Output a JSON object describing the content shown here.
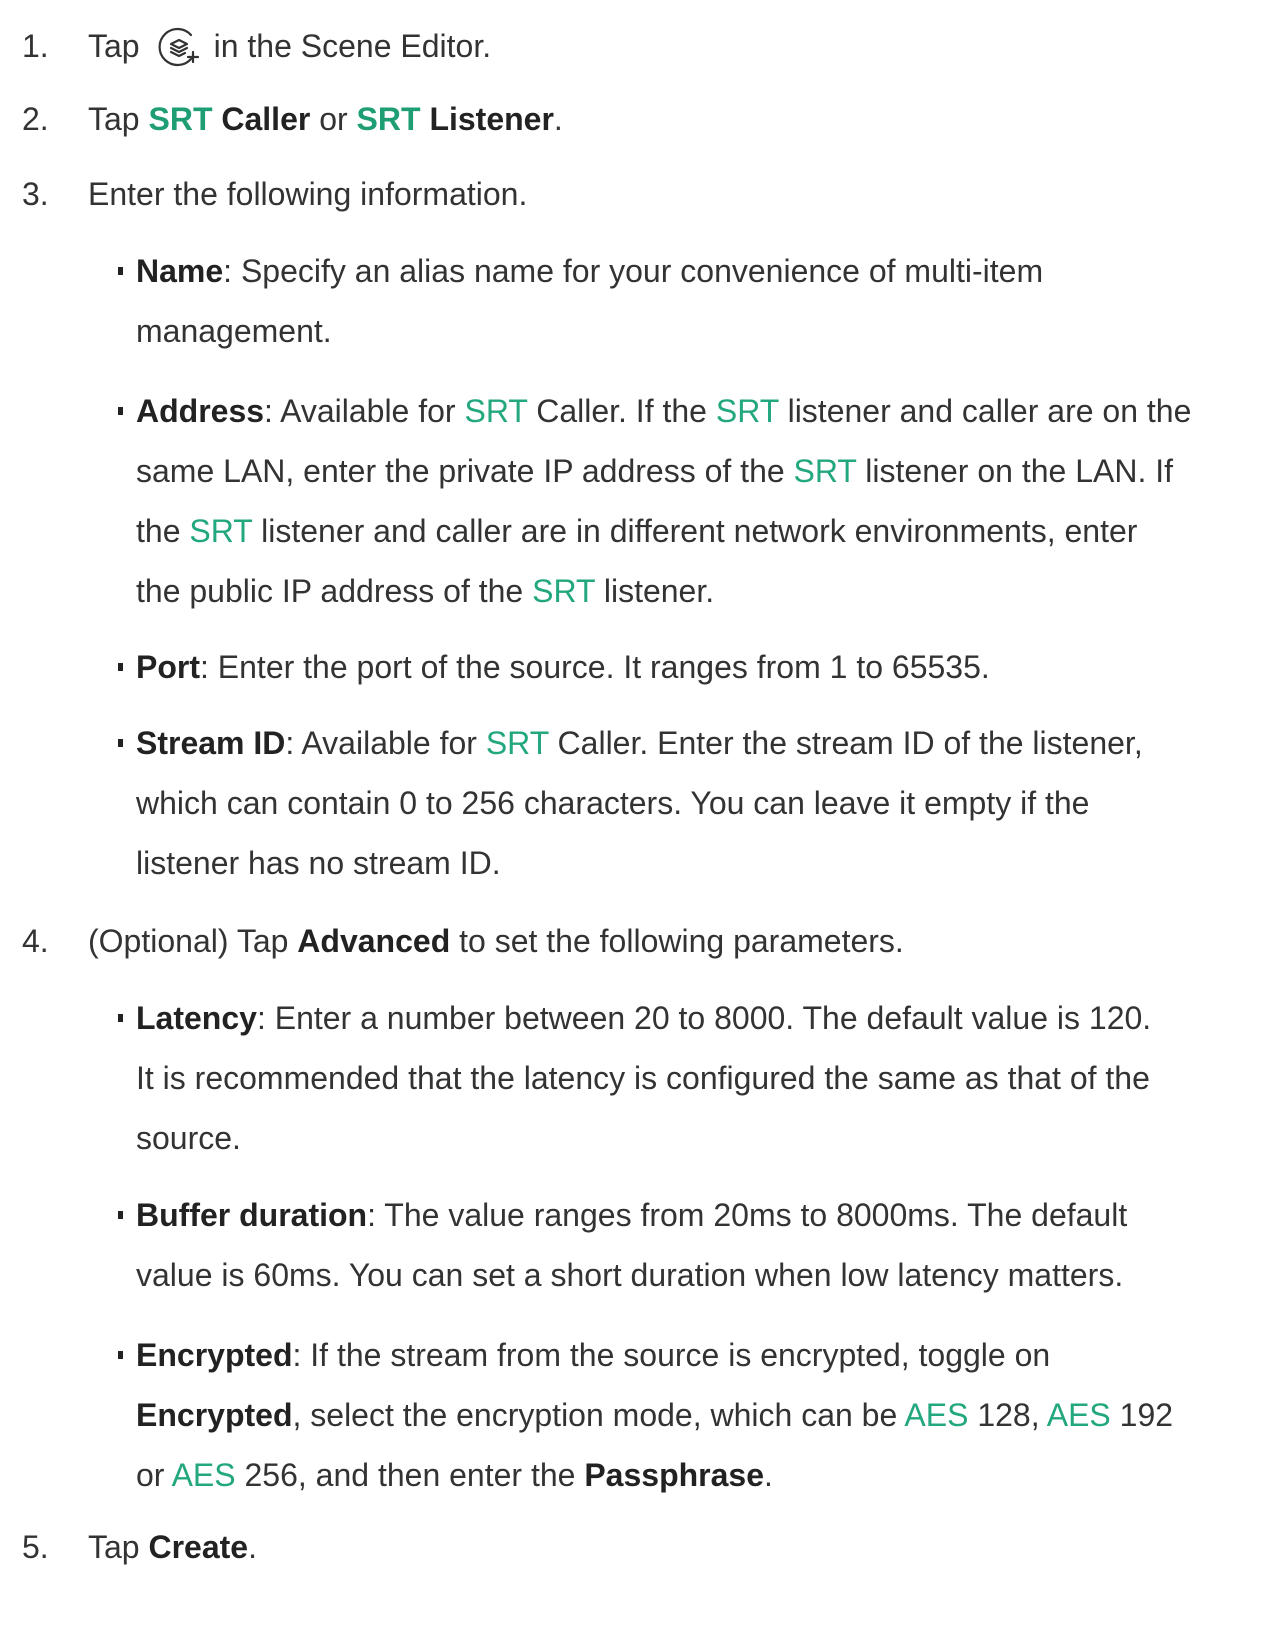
{
  "colors": {
    "accent": "#23a77e",
    "text": "#333333",
    "bold_text": "#222222"
  },
  "steps": [
    {
      "num": "1.",
      "before_icon": "Tap",
      "icon": "add-layer-icon",
      "after_icon": "in the Scene Editor."
    },
    {
      "num": "2.",
      "tap": "Tap",
      "srt1": "SRT",
      "caller": "Caller",
      "or": "or",
      "srt2": "SRT",
      "listener": "Listener",
      "end": "."
    },
    {
      "num": "3.",
      "text": "Enter the following information."
    },
    {
      "num": "4.",
      "before": "(Optional) Tap",
      "bold": "Advanced",
      "after": "to set the following parameters."
    },
    {
      "num": "5.",
      "before": "Tap",
      "bold": "Create",
      "after": "."
    }
  ],
  "info_items": [
    {
      "label": "Name",
      "lines": [
        ": Specify an alias name for your convenience of multi-item",
        "management."
      ]
    },
    {
      "label": "Address",
      "l1a": ": Available for",
      "l1b": "SRT",
      "l1c": "Caller. If the",
      "l1d": "SRT",
      "l1e": "listener and caller are on the",
      "l2a": "same LAN, enter the private IP address of the",
      "l2b": "SRT",
      "l2c": "listener on the LAN. If",
      "l3a": "the",
      "l3b": "SRT",
      "l3c": "listener and caller are in different network environments, enter",
      "l4a": "the public IP address of the",
      "l4b": "SRT",
      "l4c": "listener."
    },
    {
      "label": "Port",
      "lines": [
        ": Enter the port of the source. It ranges from 1 to 65535."
      ]
    },
    {
      "label": "Stream ID",
      "l1a": ": Available for",
      "l1b": "SRT",
      "l1c": "Caller. Enter the stream ID of the listener,",
      "l2": "which can contain 0 to 256 characters. You can leave it empty if the",
      "l3": "listener has no stream ID."
    }
  ],
  "advanced_items": [
    {
      "label": "Latency",
      "lines": [
        ": Enter a number between 20 to 8000. The default value is 120.",
        "It is recommended that the latency is configured the same as that of the",
        "source."
      ]
    },
    {
      "label": "Buffer duration",
      "lines": [
        ": The value ranges from 20ms to 8000ms. The default",
        "value is 60ms. You can set a short duration when low latency matters."
      ]
    },
    {
      "label": "Encrypted",
      "l1": ": If the stream from the source is encrypted, toggle on",
      "l2bold": "Encrypted",
      "l2a": ", select the encryption mode, which can be",
      "aes1": "AES",
      "l2b": "128,",
      "aes2": "AES",
      "l2c": "192",
      "l3a": "or",
      "aes3": "AES",
      "l3b": "256, and then enter the",
      "l3bold": "Passphrase",
      "l3c": "."
    }
  ]
}
